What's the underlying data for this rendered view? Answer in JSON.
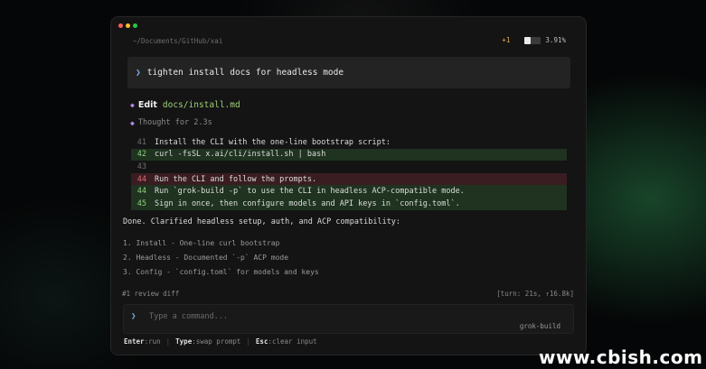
{
  "window": {
    "path": "~/Documents/GitHub/xai",
    "status": {
      "delta": "+1",
      "context_used": 0.0391,
      "context_percent": "3.91%"
    }
  },
  "prompt": {
    "text": "tighten install docs for headless mode"
  },
  "edit": {
    "verb": "Edit",
    "file": "docs/install.md"
  },
  "thought": {
    "text": "Thought for 2.3s"
  },
  "diff": [
    {
      "num": "41",
      "type": "context",
      "text": "Install the CLI with the one-line bootstrap script:"
    },
    {
      "num": "42",
      "type": "add",
      "text": "curl -fsSL x.ai/cli/install.sh | bash"
    },
    {
      "num": "43",
      "type": "context",
      "text": ""
    },
    {
      "num": "44",
      "type": "del",
      "text": "Run the CLI and follow the prompts."
    },
    {
      "num": "44",
      "type": "add",
      "text": "Run `grok-build -p` to use the CLI in headless ACP-compatible mode."
    },
    {
      "num": "45",
      "type": "add",
      "text": "Sign in once, then configure models and API keys in `config.toml`."
    }
  ],
  "summary": {
    "done": "Done. Clarified headless setup, auth, and ACP compatibility:",
    "items": [
      "1. Install - One-line curl bootstrap",
      "2. Headless - Documented `-p` ACP mode",
      "3. Config - `config.toml` for models and keys"
    ]
  },
  "footer": {
    "review": "#1 review diff",
    "turn": "[turn: 21s, ↑16.8k]"
  },
  "input": {
    "placeholder": "Type a command...",
    "model": "grok-build"
  },
  "hints": [
    {
      "key": "Enter",
      "action": ":run"
    },
    {
      "key": "Type",
      "action": ":swap prompt"
    },
    {
      "key": "Esc",
      "action": ":clear input"
    }
  ],
  "watermark": "www.cbish.com",
  "colors": {
    "accent": "#7fb0e8",
    "add": "#1f3320",
    "del": "#3a1d21",
    "diamond": "#b18cf0",
    "file": "#9fcf7a",
    "delta": "#e6b455"
  }
}
